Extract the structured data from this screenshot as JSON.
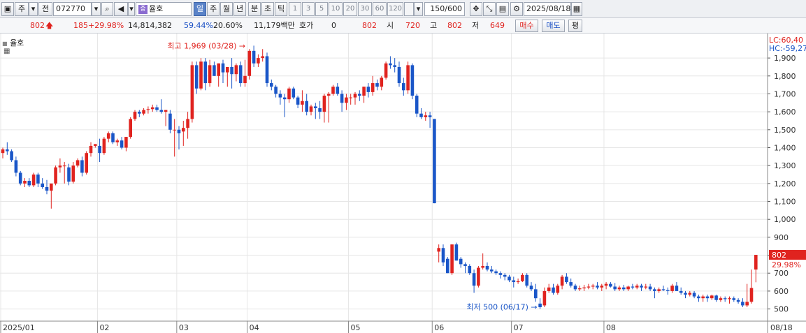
{
  "toolbar": {
    "type_label": "주",
    "jeon_label": "전",
    "code": "072770",
    "stock_name": "율호",
    "period_tabs": [
      "일",
      "주",
      "월",
      "년",
      "분",
      "초",
      "틱"
    ],
    "number_tabs": [
      "1",
      "3",
      "5",
      "10",
      "20",
      "30",
      "60",
      "120"
    ],
    "count": "150/600",
    "date": "2025/08/18"
  },
  "quote": {
    "price": "802",
    "change": "185",
    "change_rate": "+29.98%",
    "volume": "14,814,382",
    "vol_ratio": "59.44%",
    "turnover": "20.60%",
    "amount": "11,179백만",
    "hoga_label": "호가",
    "hoga_value": "0",
    "hoga_price": "802",
    "open_label": "시",
    "open": "720",
    "high_label": "고",
    "high": "802",
    "low_label": "저",
    "low": "649",
    "buy_label": "매수",
    "sell_label": "매도",
    "eval_label": "평"
  },
  "chart_data": {
    "type": "candlestick",
    "title": "율호",
    "legend": [
      "LC:60,40",
      "HC:-59,27"
    ],
    "y_ticks": [
      "1,900",
      "1,800",
      "1,700",
      "1,600",
      "1,500",
      "1,400",
      "1,300",
      "1,200",
      "1,100",
      "1,000",
      "900",
      "800",
      "700",
      "600",
      "500"
    ],
    "ylim": [
      440,
      1990
    ],
    "x_ticks": [
      "2025/01",
      "02",
      "03",
      "04",
      "05",
      "06",
      "07",
      "08",
      "08/18"
    ],
    "last_price_label": "802",
    "last_change_label": "29.98%",
    "annotations": {
      "high": "최고 1,969 (03/28)",
      "low": "최저 500 (06/17)"
    },
    "month_breaks": [
      22,
      40,
      56,
      79,
      98,
      116,
      137
    ],
    "candles": [
      [
        1370,
        1400,
        1340,
        1390
      ],
      [
        1390,
        1430,
        1360,
        1380
      ],
      [
        1380,
        1390,
        1320,
        1330
      ],
      [
        1330,
        1350,
        1240,
        1260
      ],
      [
        1260,
        1270,
        1190,
        1200
      ],
      [
        1200,
        1230,
        1180,
        1215
      ],
      [
        1215,
        1230,
        1180,
        1190
      ],
      [
        1190,
        1260,
        1180,
        1250
      ],
      [
        1250,
        1260,
        1180,
        1200
      ],
      [
        1200,
        1230,
        1170,
        1180
      ],
      [
        1180,
        1220,
        1140,
        1160
      ],
      [
        1160,
        1190,
        1060,
        1200
      ],
      [
        1200,
        1300,
        1190,
        1290
      ],
      [
        1290,
        1340,
        1260,
        1300
      ],
      [
        1300,
        1320,
        1200,
        1300
      ],
      [
        1290,
        1310,
        1190,
        1210
      ],
      [
        1210,
        1320,
        1200,
        1300
      ],
      [
        1300,
        1340,
        1290,
        1330
      ],
      [
        1330,
        1350,
        1240,
        1260
      ],
      [
        1260,
        1380,
        1250,
        1370
      ],
      [
        1370,
        1430,
        1350,
        1410
      ],
      [
        1410,
        1420,
        1400,
        1420
      ],
      [
        1410,
        1450,
        1320,
        1370
      ],
      [
        1370,
        1460,
        1360,
        1450
      ],
      [
        1450,
        1490,
        1430,
        1480
      ],
      [
        1480,
        1490,
        1420,
        1430
      ],
      [
        1430,
        1450,
        1410,
        1440
      ],
      [
        1440,
        1460,
        1390,
        1400
      ],
      [
        1400,
        1460,
        1380,
        1460
      ],
      [
        1460,
        1570,
        1450,
        1560
      ],
      [
        1560,
        1610,
        1550,
        1600
      ],
      [
        1600,
        1610,
        1570,
        1590
      ],
      [
        1590,
        1620,
        1580,
        1610
      ],
      [
        1610,
        1630,
        1590,
        1615
      ],
      [
        1615,
        1640,
        1600,
        1625
      ],
      [
        1625,
        1640,
        1600,
        1610
      ],
      [
        1610,
        1670,
        1590,
        1600
      ],
      [
        1600,
        1610,
        1520,
        1610
      ],
      [
        1590,
        1610,
        1480,
        1500
      ],
      [
        1500,
        1560,
        1350,
        1500
      ],
      [
        1500,
        1520,
        1390,
        1480
      ],
      [
        1490,
        1550,
        1410,
        1510
      ],
      [
        1510,
        1600,
        1450,
        1560
      ],
      [
        1560,
        1880,
        1540,
        1860
      ],
      [
        1860,
        1880,
        1700,
        1730
      ],
      [
        1730,
        1900,
        1720,
        1880
      ],
      [
        1880,
        1900,
        1720,
        1760
      ],
      [
        1760,
        1890,
        1740,
        1860
      ],
      [
        1860,
        1880,
        1800,
        1800
      ],
      [
        1800,
        1870,
        1740,
        1870
      ],
      [
        1870,
        1890,
        1760,
        1820
      ],
      [
        1820,
        1850,
        1740,
        1850
      ],
      [
        1850,
        1900,
        1730,
        1810
      ],
      [
        1810,
        1870,
        1770,
        1860
      ],
      [
        1860,
        1880,
        1740,
        1760
      ],
      [
        1760,
        1890,
        1740,
        1800
      ],
      [
        1800,
        1950,
        1780,
        1940
      ],
      [
        1940,
        1969,
        1850,
        1870
      ],
      [
        1870,
        1920,
        1850,
        1900
      ],
      [
        1900,
        1950,
        1880,
        1910
      ],
      [
        1910,
        1930,
        1740,
        1760
      ],
      [
        1760,
        1780,
        1720,
        1740
      ],
      [
        1740,
        1750,
        1680,
        1700
      ],
      [
        1700,
        1720,
        1640,
        1680
      ],
      [
        1680,
        1700,
        1570,
        1670
      ],
      [
        1670,
        1740,
        1650,
        1730
      ],
      [
        1730,
        1740,
        1670,
        1680
      ],
      [
        1680,
        1690,
        1620,
        1640
      ],
      [
        1640,
        1720,
        1600,
        1660
      ],
      [
        1660,
        1700,
        1580,
        1600
      ],
      [
        1600,
        1640,
        1580,
        1630
      ],
      [
        1630,
        1650,
        1560,
        1620
      ],
      [
        1620,
        1660,
        1560,
        1600
      ],
      [
        1600,
        1700,
        1540,
        1690
      ],
      [
        1690,
        1710,
        1540,
        1700
      ],
      [
        1700,
        1750,
        1690,
        1740
      ],
      [
        1740,
        1760,
        1690,
        1700
      ],
      [
        1700,
        1720,
        1600,
        1650
      ],
      [
        1650,
        1700,
        1610,
        1680
      ],
      [
        1680,
        1700,
        1640,
        1680
      ],
      [
        1680,
        1710,
        1640,
        1700
      ],
      [
        1700,
        1720,
        1660,
        1690
      ],
      [
        1690,
        1740,
        1650,
        1740
      ],
      [
        1740,
        1760,
        1680,
        1710
      ],
      [
        1710,
        1800,
        1690,
        1760
      ],
      [
        1760,
        1780,
        1720,
        1740
      ],
      [
        1740,
        1800,
        1720,
        1790
      ],
      [
        1790,
        1880,
        1780,
        1870
      ],
      [
        1870,
        1910,
        1840,
        1860
      ],
      [
        1860,
        1900,
        1820,
        1850
      ],
      [
        1850,
        1880,
        1740,
        1760
      ],
      [
        1760,
        1790,
        1690,
        1720
      ],
      [
        1720,
        1880,
        1700,
        1860
      ],
      [
        1860,
        1870,
        1670,
        1690
      ],
      [
        1690,
        1700,
        1570,
        1590
      ],
      [
        1590,
        1620,
        1560,
        1570
      ],
      [
        1570,
        1600,
        1550,
        1580
      ],
      [
        1580,
        1600,
        1510,
        1570
      ],
      [
        1560,
        1560,
        1090,
        1090
      ],
      [
        820,
        860,
        760,
        840
      ],
      [
        840,
        860,
        740,
        760
      ],
      [
        780,
        790,
        700,
        700
      ],
      [
        700,
        860,
        690,
        860
      ],
      [
        860,
        870,
        770,
        770
      ],
      [
        780,
        790,
        730,
        750
      ],
      [
        750,
        760,
        700,
        740
      ],
      [
        740,
        750,
        690,
        700
      ],
      [
        700,
        720,
        590,
        630
      ],
      [
        630,
        740,
        620,
        730
      ],
      [
        730,
        810,
        720,
        740
      ],
      [
        740,
        760,
        710,
        720
      ],
      [
        720,
        740,
        700,
        710
      ],
      [
        710,
        720,
        690,
        700
      ],
      [
        700,
        710,
        670,
        690
      ],
      [
        690,
        700,
        660,
        680
      ],
      [
        680,
        690,
        650,
        660
      ],
      [
        660,
        680,
        620,
        650
      ],
      [
        650,
        670,
        640,
        655
      ],
      [
        655,
        700,
        650,
        690
      ],
      [
        690,
        700,
        620,
        630
      ],
      [
        630,
        650,
        600,
        610
      ],
      [
        610,
        640,
        540,
        560
      ],
      [
        530,
        560,
        500,
        510
      ],
      [
        520,
        620,
        510,
        600
      ],
      [
        600,
        640,
        590,
        620
      ],
      [
        620,
        640,
        580,
        590
      ],
      [
        590,
        640,
        580,
        630
      ],
      [
        630,
        690,
        610,
        680
      ],
      [
        680,
        700,
        640,
        650
      ],
      [
        650,
        670,
        620,
        630
      ],
      [
        630,
        640,
        600,
        610
      ],
      [
        610,
        630,
        600,
        615
      ],
      [
        615,
        635,
        600,
        620
      ],
      [
        620,
        640,
        610,
        625
      ],
      [
        625,
        640,
        610,
        630
      ],
      [
        630,
        650,
        610,
        620
      ],
      [
        620,
        640,
        600,
        630
      ],
      [
        630,
        650,
        610,
        640
      ],
      [
        640,
        650,
        620,
        625
      ],
      [
        625,
        645,
        600,
        610
      ],
      [
        610,
        630,
        600,
        620
      ],
      [
        620,
        635,
        600,
        610
      ],
      [
        610,
        630,
        600,
        625
      ],
      [
        625,
        640,
        610,
        620
      ],
      [
        620,
        640,
        610,
        630
      ],
      [
        630,
        640,
        600,
        620
      ],
      [
        620,
        640,
        610,
        625
      ],
      [
        625,
        640,
        600,
        610
      ],
      [
        610,
        620,
        560,
        600
      ],
      [
        600,
        620,
        590,
        610
      ],
      [
        610,
        630,
        600,
        605
      ],
      [
        605,
        620,
        580,
        600
      ],
      [
        600,
        640,
        590,
        630
      ],
      [
        630,
        650,
        610,
        600
      ],
      [
        600,
        620,
        580,
        590
      ],
      [
        590,
        600,
        560,
        580
      ],
      [
        580,
        600,
        570,
        590
      ],
      [
        590,
        600,
        560,
        570
      ],
      [
        570,
        580,
        540,
        560
      ],
      [
        560,
        580,
        540,
        570
      ],
      [
        570,
        580,
        540,
        560
      ],
      [
        560,
        580,
        550,
        575
      ],
      [
        575,
        580,
        540,
        550
      ],
      [
        550,
        570,
        540,
        560
      ],
      [
        560,
        570,
        540,
        555
      ],
      [
        555,
        570,
        530,
        560
      ],
      [
        560,
        570,
        540,
        550
      ],
      [
        550,
        560,
        530,
        540
      ],
      [
        540,
        560,
        510,
        520
      ],
      [
        520,
        640,
        510,
        540
      ],
      [
        540,
        720,
        530,
        617
      ],
      [
        720,
        802,
        649,
        802
      ]
    ]
  }
}
